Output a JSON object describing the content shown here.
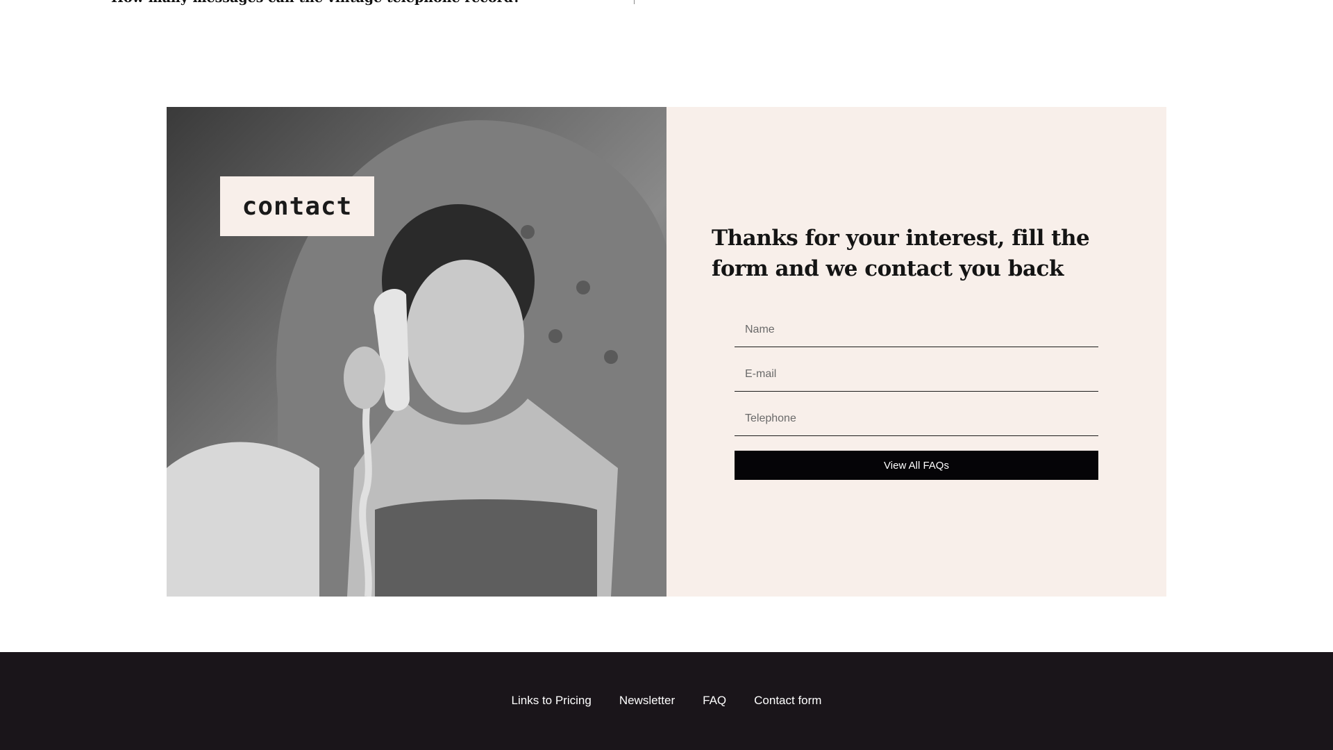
{
  "faq": {
    "cut_question": "How many messages can the vintage telephone record?"
  },
  "contact": {
    "tag_label": "contact",
    "heading": "Thanks for your interest, fill the form and we contact you back",
    "fields": {
      "name_placeholder": "Name",
      "email_placeholder": "E-mail",
      "phone_placeholder": "Telephone"
    },
    "submit_label": "View All FAQs"
  },
  "footer": {
    "links": [
      "Links to Pricing",
      "Newsletter",
      "FAQ",
      "Contact form"
    ]
  },
  "colors": {
    "panel_bg": "#f8efea",
    "button_bg": "#050407",
    "footer_bg": "#1a151a"
  }
}
